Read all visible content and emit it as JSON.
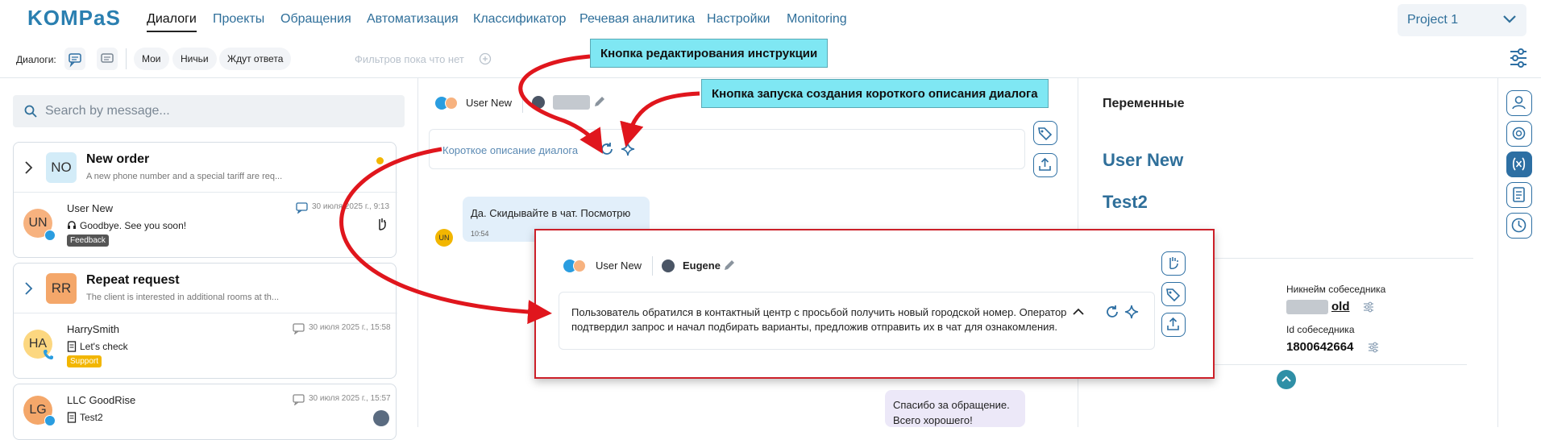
{
  "app": {
    "logo": "KOMPaS",
    "nav": [
      "Диалоги",
      "Проекты",
      "Обращения",
      "Автоматизация",
      "Классификатор",
      "Речевая аналитика",
      "Настройки",
      "Monitoring"
    ],
    "project": "Project 1"
  },
  "filters": {
    "label": "Диалоги:",
    "chips": [
      "Мои",
      "Ничьи",
      "Ждут ответа"
    ],
    "empty": "Фильтров пока что нет"
  },
  "search": {
    "placeholder": "Search by message..."
  },
  "groups": [
    {
      "avatar": "NO",
      "title": "New order",
      "subtitle": "A new phone number and a special tariff are req...",
      "conversation": {
        "avatar": "UN",
        "name": "User New",
        "date": "30 июля 2025 г., 9:13",
        "message": "Goodbye. See you soon!",
        "tag": "Feedback"
      }
    },
    {
      "avatar": "RR",
      "title": "Repeat request",
      "subtitle": "The client is interested in additional rooms at th...",
      "conversation": {
        "avatar": "HA",
        "name": "HarrySmith",
        "date": "30 июля 2025 г., 15:58",
        "message": "Let's check",
        "tag": "Support"
      }
    }
  ],
  "conversation3": {
    "avatar": "LG",
    "name": "LLC GoodRise",
    "date": "30 июля 2025 г., 15:57",
    "message": "Test2"
  },
  "chat": {
    "user": "User New",
    "summary_placeholder": "Короткое описание диалога",
    "msg1": {
      "text": "Да. Скидывайте в чат. Посмотрю",
      "time": "10:54",
      "avatar": "UN"
    },
    "msg2": {
      "line1": "Спасибо за обращение.",
      "line2": "Всего хорошего!"
    }
  },
  "zoom": {
    "user": "User New",
    "operator": "Eugene",
    "summary": "Пользователь обратился в контактный центр с просьбой получить новый городской номер. Оператор подтвердил запрос и начал подбирать варианты, предложив отправить их в чат для ознакомления."
  },
  "vars": {
    "title": "Переменные",
    "name1": "User New",
    "name2": "Test2",
    "nick_label": "Никнейм собеседника",
    "nick_value": "old",
    "id_label": "Id собеседника",
    "id_value": "1800642664"
  },
  "callouts": {
    "edit": "Кнопка редактирования инструкции",
    "summary": "Кнопка запуска создания короткого описания диалога"
  },
  "colors": {
    "accent": "#2d6fa3",
    "callout_bg": "#7fe7f3",
    "arrow": "#e0161d"
  }
}
